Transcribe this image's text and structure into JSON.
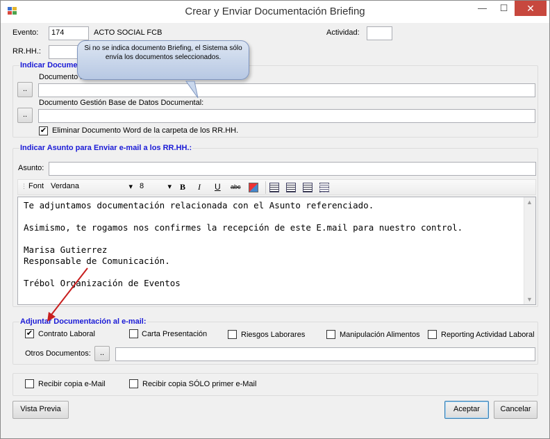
{
  "window": {
    "title": "Crear y Enviar Documentación Briefing",
    "min": "—",
    "max": "☐",
    "close": "✕"
  },
  "top": {
    "evento_label": "Evento:",
    "evento_value": "174",
    "evento_name": "ACTO SOCIAL FCB",
    "actividad_label": "Actividad:",
    "actividad_value": "",
    "rrhh_label": "RR.HH.:",
    "rrhh_value": ""
  },
  "tooltip": "Si no se indica documento Briefing, el Sistema sólo envía los documentos seleccionados.",
  "briefing": {
    "title": "Indicar Documento Briefing",
    "word_label": "Documento MS Word:",
    "word_button": "..",
    "word_value": "",
    "gestion_label": "Documento Gestión Base de Datos Documental:",
    "gestion_button": "..",
    "gestion_value": "",
    "eliminar_label": "Eliminar Documento Word de la carpeta de los RR.HH.",
    "eliminar_checked": "✔"
  },
  "asunto_group": {
    "title": "Indicar Asunto para Enviar e-mail a los RR.HH.:",
    "asunto_label": "Asunto:",
    "asunto_value": ""
  },
  "toolbar": {
    "font_label": "Font",
    "font_value": "Verdana",
    "size_value": "8",
    "bold": "B",
    "italic": "I",
    "underline": "U",
    "strike": "abc",
    "dropdown": "▾"
  },
  "editor_text": "Te adjuntamos documentación relacionada con el Asunto referenciado.\n\nAsimismo, te rogamos nos confirmes la recepción de este E.mail para nuestro control.\n\nMarisa Gutierrez\nResponsable de Comunicación.\n\nTrébol Organización de Eventos",
  "adjuntar": {
    "title": "Adjuntar Documentación al e-mail:",
    "checks": [
      {
        "label": "Contrato Laboral",
        "mark": "✔"
      },
      {
        "label": "Carta Presentación",
        "mark": ""
      },
      {
        "label": "Riesgos Laborares",
        "mark": ""
      },
      {
        "label": "Manipulación Alimentos",
        "mark": ""
      },
      {
        "label": "Reporting Actividad Laboral",
        "mark": ""
      }
    ],
    "otros_label": "Otros Documentos:",
    "otros_button": "..",
    "otros_value": ""
  },
  "copias": {
    "copia_label": "Recibir copia e-Mail",
    "copia_solo_label": "Recibir copia SÓLO primer e-Mail"
  },
  "footer": {
    "vista_previa": "Vista Previa",
    "aceptar": "Aceptar",
    "cancelar": "Cancelar"
  },
  "colors": {
    "group_title": "#1a1ad6",
    "arrow": "#c81e1e",
    "close_bg": "#c7483e"
  }
}
